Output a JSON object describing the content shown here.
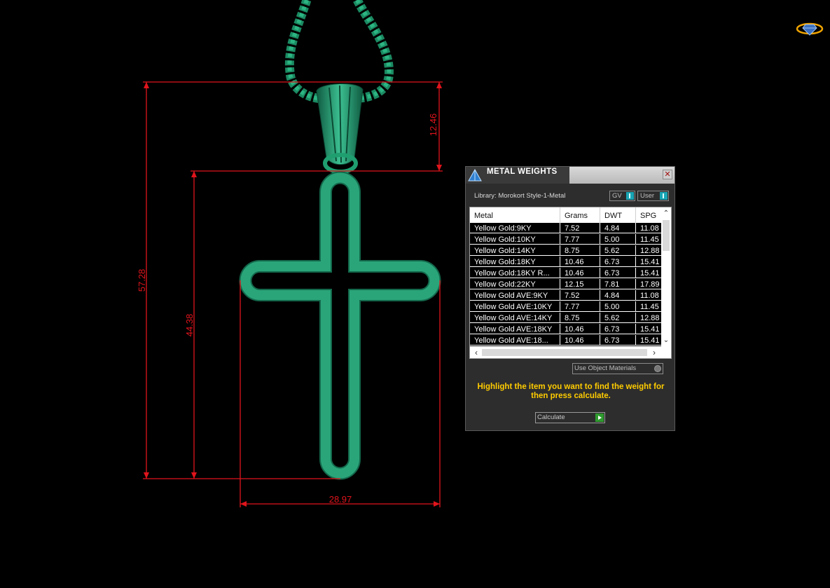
{
  "dimensions": {
    "total_height": "57.28",
    "cross_height": "44.38",
    "bail_height": "12.46",
    "cross_width": "28.97"
  },
  "panel": {
    "title": "METAL WEIGHTS",
    "close_icon": "close-icon",
    "library_label": "Library: Morokort Style-1-Metal",
    "toggles": {
      "gv": "GV",
      "user": "User"
    },
    "table": {
      "columns": [
        "Metal",
        "Grams",
        "DWT",
        "SPG"
      ],
      "rows": [
        [
          "Yellow Gold:9KY",
          "7.52",
          "4.84",
          "11.08"
        ],
        [
          "Yellow Gold:10KY",
          "7.77",
          "5.00",
          "11.45"
        ],
        [
          "Yellow Gold:14KY",
          "8.75",
          "5.62",
          "12.88"
        ],
        [
          "Yellow Gold:18KY",
          "10.46",
          "6.73",
          "15.41"
        ],
        [
          "Yellow Gold:18KY R...",
          "10.46",
          "6.73",
          "15.41"
        ],
        [
          "Yellow Gold:22KY",
          "12.15",
          "7.81",
          "17.89"
        ],
        [
          "Yellow Gold AVE:9KY",
          "7.52",
          "4.84",
          "11.08"
        ],
        [
          "Yellow Gold AVE:10KY",
          "7.77",
          "5.00",
          "11.45"
        ],
        [
          "Yellow Gold AVE:14KY",
          "8.75",
          "5.62",
          "12.88"
        ],
        [
          "Yellow Gold AVE:18KY",
          "10.46",
          "6.73",
          "15.41"
        ],
        [
          "Yellow Gold AVE:18...",
          "10.46",
          "6.73",
          "15.41"
        ]
      ]
    },
    "use_object_materials": "Use Object Materials",
    "instruction": "Highlight the item you want to find the weight for then press calculate.",
    "calculate_label": "Calculate"
  },
  "colors": {
    "model": "#2aa57a",
    "dimension": "#e0141c",
    "instruction": "#ffcc00",
    "toggle_knob": "#19a5b5"
  }
}
